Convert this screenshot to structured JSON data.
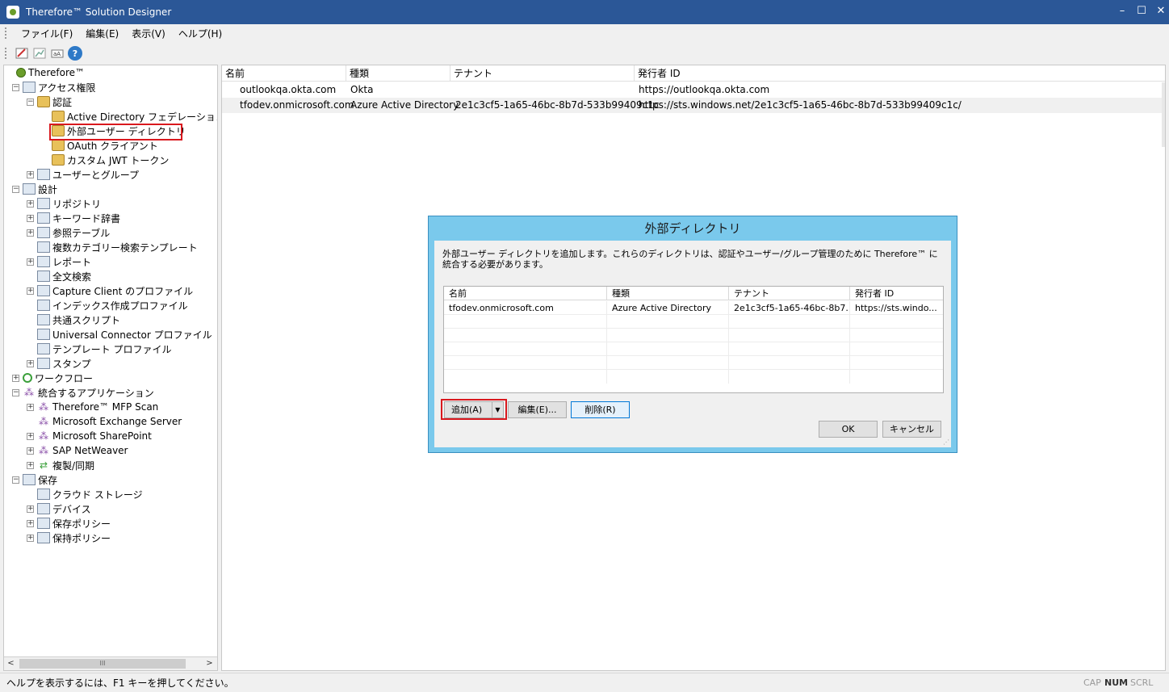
{
  "window": {
    "title": "Therefore™ Solution Designer",
    "controls": {
      "minimize": "–",
      "maximize": "☐",
      "close": "✕"
    }
  },
  "menu": [
    "ファイル(F)",
    "編集(E)",
    "表示(V)",
    "ヘルプ(H)"
  ],
  "toolbar": {
    "help": "?"
  },
  "tree": {
    "items": [
      {
        "label": "Therefore™",
        "icon": "therefore-globe-icon",
        "level": 0,
        "exp": ""
      },
      {
        "label": "アクセス権限",
        "icon": "access-rights-icon",
        "level": 1,
        "exp": "−"
      },
      {
        "label": "認証",
        "icon": "folder-key-icon",
        "level": 2,
        "exp": "−"
      },
      {
        "label": "Active Directory フェデレーション サ",
        "icon": "folder-key-icon",
        "level": 3,
        "exp": ""
      },
      {
        "label": "外部ユーザー ディレクトリ",
        "icon": "folder-key-icon",
        "level": 3,
        "exp": "",
        "selected": true
      },
      {
        "label": "OAuth クライアント",
        "icon": "folder-key-icon",
        "level": 3,
        "exp": ""
      },
      {
        "label": "カスタム JWT トークン",
        "icon": "folder-key-icon",
        "level": 3,
        "exp": ""
      },
      {
        "label": "ユーザーとグループ",
        "icon": "users-icon",
        "level": 2,
        "exp": "+"
      },
      {
        "label": "設計",
        "icon": "design-icon",
        "level": 1,
        "exp": "−"
      },
      {
        "label": "リポジトリ",
        "icon": "repository-icon",
        "level": 2,
        "exp": "+"
      },
      {
        "label": "キーワード辞書",
        "icon": "keyword-dictionary-icon",
        "level": 2,
        "exp": "+"
      },
      {
        "label": "参照テーブル",
        "icon": "reference-table-icon",
        "level": 2,
        "exp": "+"
      },
      {
        "label": "複数カテゴリー検索テンプレート",
        "icon": "search-template-icon",
        "level": 2,
        "exp": ""
      },
      {
        "label": "レポート",
        "icon": "report-icon",
        "level": 2,
        "exp": "+"
      },
      {
        "label": "全文検索",
        "icon": "fulltext-search-icon",
        "level": 2,
        "exp": ""
      },
      {
        "label": "Capture Client のプロファイル",
        "icon": "capture-profile-icon",
        "level": 2,
        "exp": "+"
      },
      {
        "label": "インデックス作成プロファイル",
        "icon": "index-profile-icon",
        "level": 2,
        "exp": ""
      },
      {
        "label": "共通スクリプト",
        "icon": "script-icon",
        "level": 2,
        "exp": ""
      },
      {
        "label": "Universal Connector プロファイル",
        "icon": "universal-connector-icon",
        "level": 2,
        "exp": ""
      },
      {
        "label": "テンプレート プロファイル",
        "icon": "template-profile-icon",
        "level": 2,
        "exp": ""
      },
      {
        "label": "スタンプ",
        "icon": "stamp-icon",
        "level": 2,
        "exp": "+"
      },
      {
        "label": "ワークフロー",
        "icon": "workflow-icon",
        "level": 1,
        "exp": "+"
      },
      {
        "label": "統合するアプリケーション",
        "icon": "integration-icon",
        "level": 1,
        "exp": "−"
      },
      {
        "label": "Therefore™ MFP Scan",
        "icon": "mfp-scan-icon",
        "level": 2,
        "exp": "+"
      },
      {
        "label": "Microsoft Exchange Server",
        "icon": "exchange-icon",
        "level": 2,
        "exp": ""
      },
      {
        "label": "Microsoft SharePoint",
        "icon": "sharepoint-icon",
        "level": 2,
        "exp": "+"
      },
      {
        "label": "SAP NetWeaver",
        "icon": "sap-icon",
        "level": 2,
        "exp": "+"
      },
      {
        "label": "複製/同期",
        "icon": "sync-icon",
        "level": 2,
        "exp": "+"
      },
      {
        "label": "保存",
        "icon": "storage-icon",
        "level": 1,
        "exp": "−"
      },
      {
        "label": "クラウド ストレージ",
        "icon": "cloud-storage-icon",
        "level": 2,
        "exp": ""
      },
      {
        "label": "デバイス",
        "icon": "device-icon",
        "level": 2,
        "exp": "+"
      },
      {
        "label": "保存ポリシー",
        "icon": "storage-policy-icon",
        "level": 2,
        "exp": "+"
      },
      {
        "label": "保持ポリシー",
        "icon": "retention-policy-icon",
        "level": 2,
        "exp": "+"
      }
    ],
    "hscroll_left": "<",
    "hscroll_right": ">",
    "hscroll_thumb": "III"
  },
  "list": {
    "columns": [
      "名前",
      "種類",
      "テナント",
      "発行者 ID"
    ],
    "rows": [
      [
        "outlookqa.okta.com",
        "Okta",
        "",
        "https://outlookqa.okta.com"
      ],
      [
        "tfodev.onmicrosoft.com",
        "Azure Active Directory",
        "2e1c3cf5-1a65-46bc-8b7d-533b99409c1c",
        "https://sts.windows.net/2e1c3cf5-1a65-46bc-8b7d-533b99409c1c/"
      ]
    ]
  },
  "dialog": {
    "title": "外部ディレクトリ",
    "description": "外部ユーザー ディレクトリを追加します。これらのディレクトリは、認証やユーザー/グループ管理のために Therefore™ に統合する必要があります。",
    "columns": [
      "名前",
      "種類",
      "テナント",
      "発行者 ID"
    ],
    "rows": [
      [
        "tfodev.onmicrosoft.com",
        "Azure Active Directory",
        "2e1c3cf5-1a65-46bc-8b7...",
        "https://sts.windo..."
      ]
    ],
    "buttons": {
      "add": "追加(A)",
      "edit": "編集(E)...",
      "delete": "削除(R)",
      "ok": "OK",
      "cancel": "キャンセル"
    }
  },
  "status": {
    "text": "ヘルプを表示するには、F1 キーを押してください。",
    "cap": "CAP",
    "num": "NUM",
    "scrl": "SCRL"
  },
  "colors": {
    "titlebar": "#2b5797",
    "dialog_frame": "#7ac9ec",
    "highlight": "#d9181e"
  }
}
